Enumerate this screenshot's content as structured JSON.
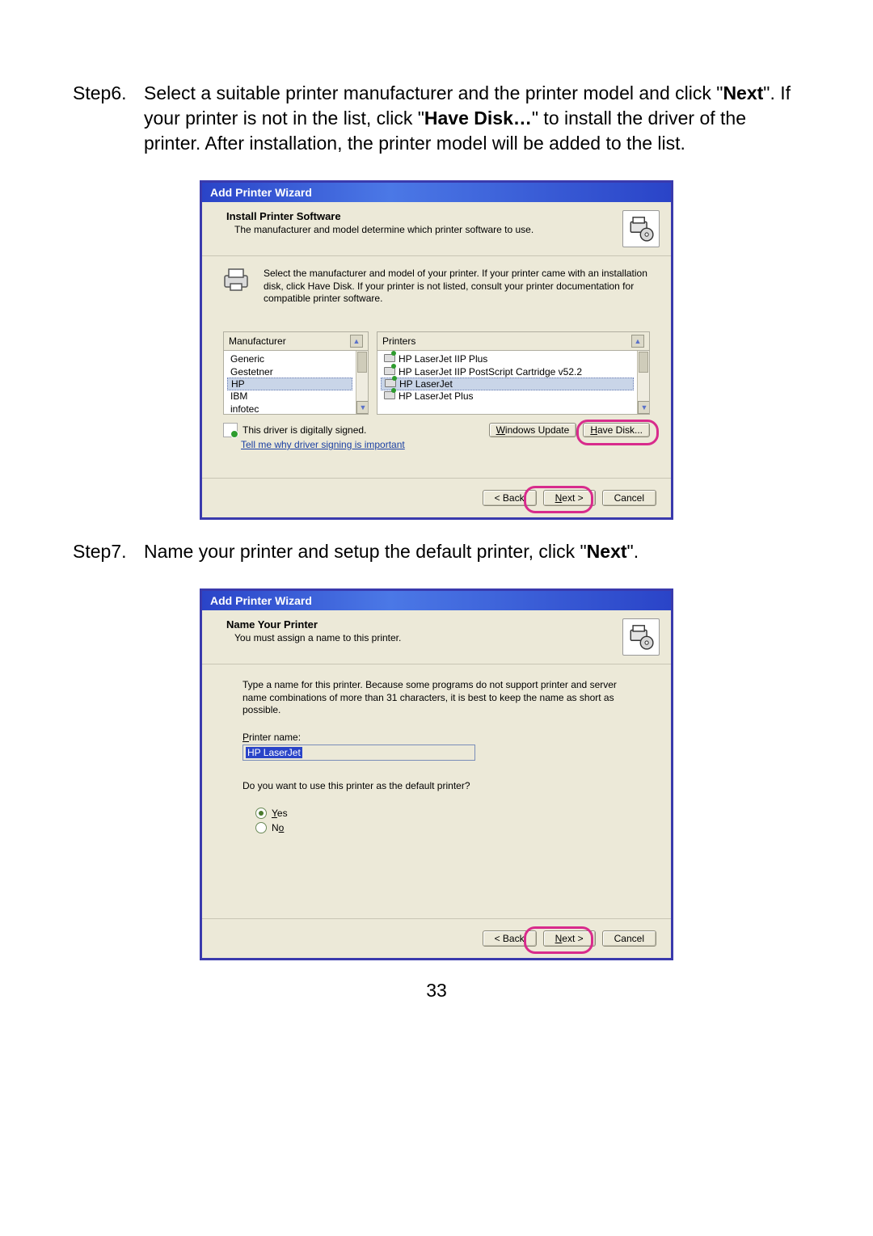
{
  "page_number": "33",
  "step6": {
    "label": "Step6.",
    "text_pre": "Select a suitable printer manufacturer and the printer model and click \"",
    "next_word": "Next",
    "text_mid": "\". If your printer is not in the list, click \"",
    "havedisk_word": "Have Disk…",
    "text_post": "\" to install the driver of the printer. After installation, the printer model will be added to the list."
  },
  "step7": {
    "label": "Step7.",
    "text_pre": "Name your printer and setup the default printer, click \"",
    "next_word": "Next",
    "text_post": "\"."
  },
  "wizard1": {
    "title": "Add Printer Wizard",
    "header_title": "Install Printer Software",
    "header_sub": "The manufacturer and model determine which printer software to use.",
    "body_msg": "Select the manufacturer and model of your printer. If your printer came with an installation disk, click Have Disk. If your printer is not listed, consult your printer documentation for compatible printer software.",
    "manu_header": "Manufacturer",
    "printers_header": "Printers",
    "manufacturers": [
      "Generic",
      "Gestetner",
      "HP",
      "IBM",
      "infotec"
    ],
    "manufacturer_selected_index": 2,
    "printers": [
      "HP LaserJet IIP Plus",
      "HP LaserJet IIP PostScript Cartridge v52.2",
      "HP LaserJet",
      "HP LaserJet Plus"
    ],
    "printers_selected_index": 2,
    "signed_text": "This driver is digitally signed.",
    "signing_link": "Tell me why driver signing is important",
    "btn_windows_update": "Windows Update",
    "btn_have_disk": "Have Disk...",
    "btn_back": "< Back",
    "btn_next": "Next >",
    "btn_cancel": "Cancel"
  },
  "wizard2": {
    "title": "Add Printer Wizard",
    "header_title": "Name Your Printer",
    "header_sub": "You must assign a name to this printer.",
    "body_msg": "Type a name for this printer. Because some programs do not support printer and server name combinations of more than 31 characters, it is best to keep the name as short as possible.",
    "printer_name_label": "Printer name:",
    "printer_name_value": "HP LaserJet",
    "default_question": "Do you want to use this printer as the default printer?",
    "yes_label": "Yes",
    "no_label": "No",
    "default_selected": "yes",
    "btn_back": "< Back",
    "btn_next": "Next >",
    "btn_cancel": "Cancel"
  },
  "colors": {
    "wizard_border": "#3a3aad",
    "annotation_pink": "#d82b8c"
  }
}
